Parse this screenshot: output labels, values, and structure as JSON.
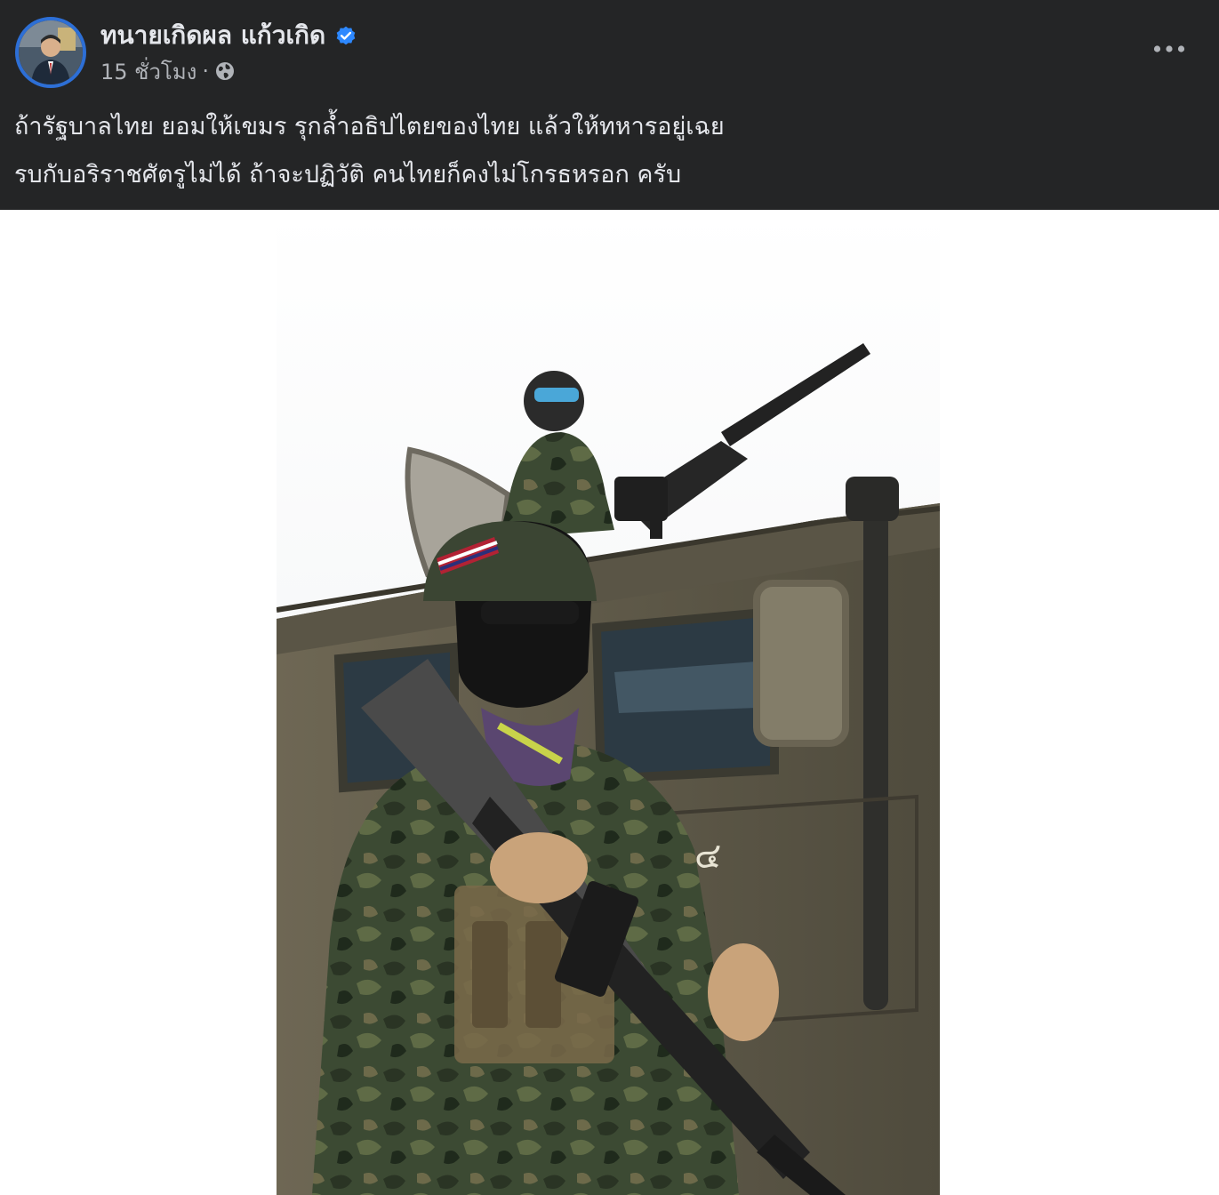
{
  "post": {
    "author_name": "ทนายเกิดผล แก้วเกิด",
    "timestamp": "15 ชั่วโมง",
    "separator": "·",
    "audience_icon": "globe-icon",
    "verified_icon": "verified-badge-icon",
    "more_icon": "more-options-icon",
    "text_lines": [
      "ถ้ารัฐบาลไทย ยอมให้เขมร รุกล้ำอธิปไตยของไทย  แล้วให้ทหารอยู่เฉย",
      "รบกับอริราชศัตรูไม่ได้ ถ้าจะปฏิวัติ คนไทยก็คงไม่โกรธหรอก ครับ"
    ]
  },
  "photo": {
    "vehicle_marking": "๔"
  },
  "colors": {
    "header_bg": "#242526",
    "text_primary": "#e4e6eb",
    "text_secondary": "#b0b3b8",
    "verified_blue": "#2d88ff",
    "avatar_ring": "#2d6fd6"
  }
}
